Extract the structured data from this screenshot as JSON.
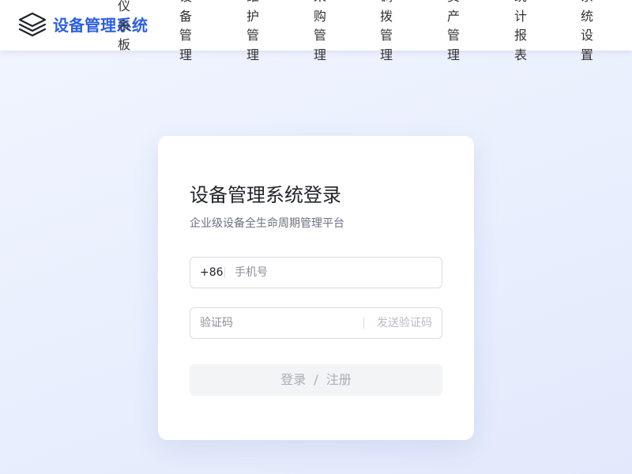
{
  "header": {
    "logo_icon": "stacked-layers-icon",
    "app_name": "设备管理系统",
    "accent_color": "#2c5fe0",
    "nav": [
      {
        "label": "仪表板"
      },
      {
        "label": "设备管理"
      },
      {
        "label": "维护管理"
      },
      {
        "label": "采购管理"
      },
      {
        "label": "调拨管理"
      },
      {
        "label": "资产管理"
      },
      {
        "label": "统计报表"
      },
      {
        "label": "系统设置"
      }
    ]
  },
  "login": {
    "title": "设备管理系统登录",
    "subtitle": "企业级设备全生命周期管理平台",
    "phone": {
      "country_code": "+86",
      "placeholder": "手机号",
      "value": ""
    },
    "code": {
      "placeholder": "验证码",
      "value": "",
      "send_label": "发送验证码"
    },
    "submit": {
      "login_label": "登录",
      "separator": "/",
      "register_label": "注册"
    }
  }
}
